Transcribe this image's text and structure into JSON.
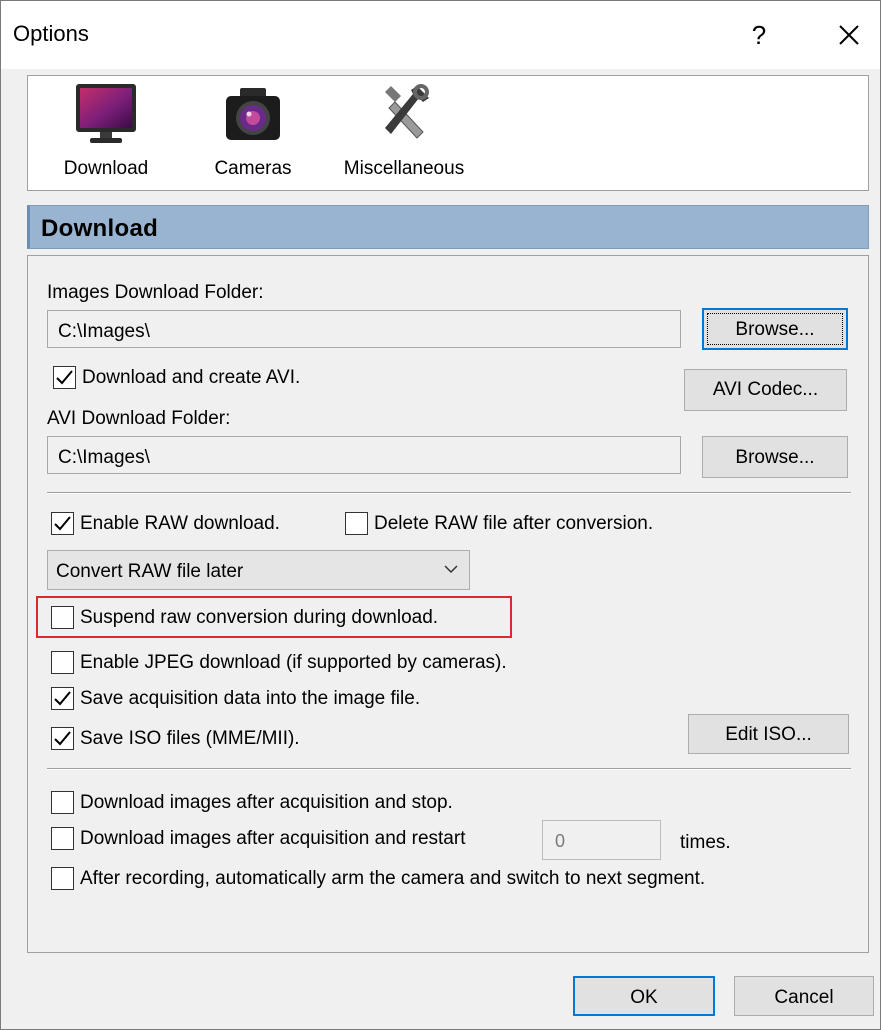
{
  "window": {
    "title": "Options",
    "help_label": "?"
  },
  "toolbar": {
    "items": [
      {
        "label": "Download",
        "icon": "monitor-icon"
      },
      {
        "label": "Cameras",
        "icon": "camera-icon"
      },
      {
        "label": "Miscellaneous",
        "icon": "tools-icon"
      }
    ]
  },
  "section": {
    "title": "Download"
  },
  "download": {
    "images_folder_label": "Images Download Folder:",
    "images_folder_value": "C:\\Images\\",
    "browse_label": "Browse...",
    "avi_checkbox": {
      "label": "Download and create AVI.",
      "checked": true
    },
    "avi_codec_label": "AVI Codec...",
    "avi_folder_label": "AVI Download Folder:",
    "avi_folder_value": "C:\\Images\\",
    "browse2_label": "Browse..."
  },
  "raw": {
    "enable": {
      "label": "Enable RAW download.",
      "checked": true
    },
    "delete": {
      "label": "Delete RAW file after conversion.",
      "checked": false
    },
    "mode_value": "Convert RAW file later",
    "suspend": {
      "label": "Suspend raw conversion during download.",
      "checked": false
    },
    "jpeg": {
      "label": "Enable JPEG download (if supported by cameras).",
      "checked": false
    },
    "save_acq": {
      "label": "Save acquisition data into the image file.",
      "checked": true
    },
    "save_iso": {
      "label": "Save ISO files (MME/MII).",
      "checked": true
    },
    "edit_iso_label": "Edit ISO..."
  },
  "after": {
    "stop": {
      "label": "Download images after acquisition and stop.",
      "checked": false
    },
    "restart": {
      "label": "Download images after acquisition and restart",
      "checked": false
    },
    "restart_count": "0",
    "times_label": "times.",
    "arm": {
      "label": "After recording, automatically arm the camera and switch to next segment.",
      "checked": false
    }
  },
  "footer": {
    "ok_label": "OK",
    "cancel_label": "Cancel"
  },
  "colors": {
    "header_bg": "#99b4d1",
    "highlight": "#e0262e",
    "focus": "#0078d7"
  }
}
